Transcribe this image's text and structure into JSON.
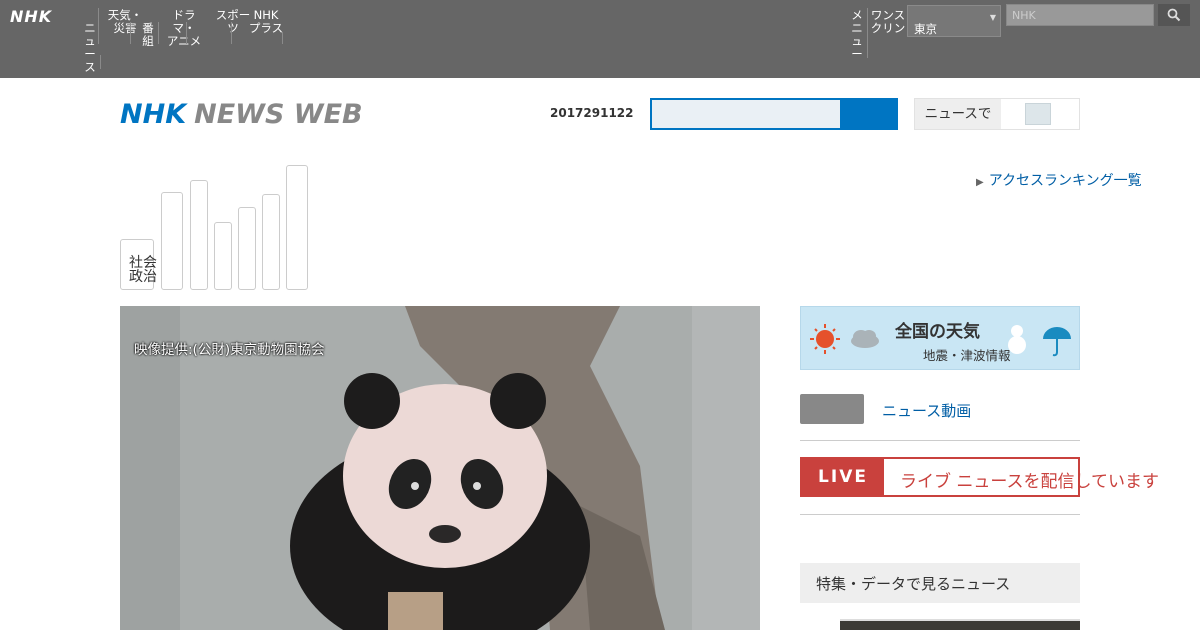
{
  "global_bar": {
    "logo": "NHK",
    "nav": [
      {
        "label": "ニュ\nース"
      },
      {
        "label": "天気・\n災害"
      },
      {
        "label": "番組"
      },
      {
        "label": "ドラマ・\nアニメ"
      },
      {
        "label": "スポー\nツ"
      },
      {
        "label": "NHK\nプラス"
      }
    ],
    "right_nav": [
      {
        "label": "メニ\nュー"
      },
      {
        "label": "ワンス\nクリン"
      }
    ],
    "select_value": "東京",
    "search_placeholder": "NHK"
  },
  "header": {
    "logo_primary": "NHK",
    "logo_secondary": "NEWS WEB",
    "date": "2017291122",
    "search_value": "",
    "toggle_label": "ニュースで",
    "toggle_state": "off"
  },
  "categories": [
    {
      "label": "社会\n政治",
      "level": 0.34
    },
    {
      "label": "",
      "level": 0.65
    },
    {
      "label": "",
      "level": 0.73
    },
    {
      "label": "",
      "level": 0.45
    },
    {
      "label": "",
      "level": 0.55
    },
    {
      "label": "",
      "level": 0.64
    },
    {
      "label": "",
      "level": 0.83
    }
  ],
  "ranking_link": "アクセスランキング一覧",
  "main_story": {
    "image_caption": "映像提供:(公財)東京動物園協会"
  },
  "sidebar": {
    "weather_title": "全国の天気",
    "weather_sub": "地震・津波情報",
    "link_label": "ニュース動画",
    "live_tag": "LIVE",
    "live_text": "ライブ ニュースを配信しています",
    "section_title": "特集・データで見るニュース"
  },
  "colors": {
    "nhk_blue": "#0075c2",
    "live_red": "#c9413d",
    "topbar_gray": "#666666"
  }
}
